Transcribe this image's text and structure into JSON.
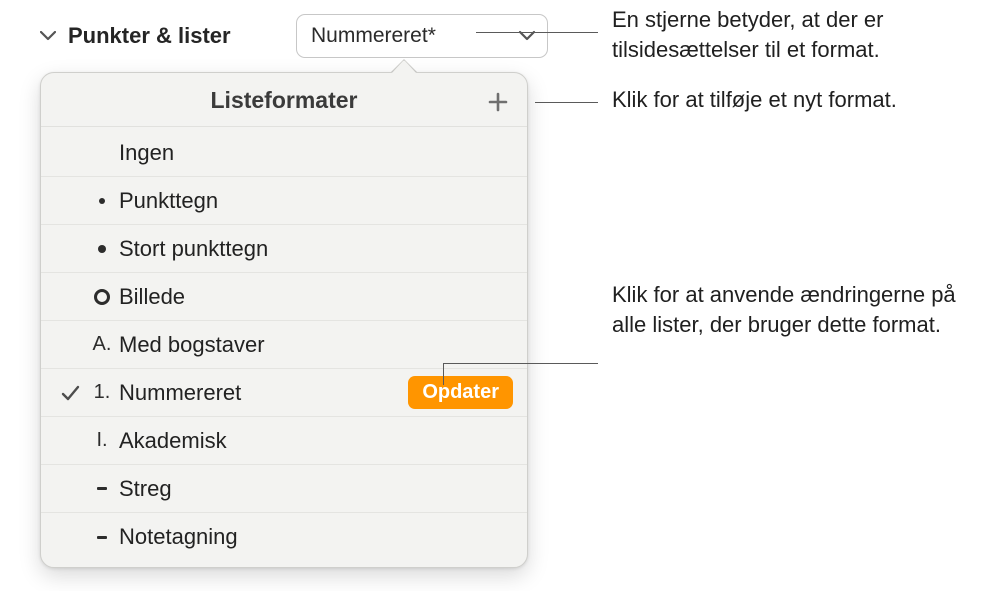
{
  "panel": {
    "section_title": "Punkter & lister",
    "dropdown_value": "Nummereret*"
  },
  "popover": {
    "title": "Listeformater",
    "update_label": "Opdater",
    "items": [
      {
        "marker_type": "none",
        "label": "Ingen",
        "checked": false
      },
      {
        "marker_type": "dot_sm",
        "label": "Punkttegn",
        "checked": false
      },
      {
        "marker_type": "dot_lg",
        "label": "Stort punkttegn",
        "checked": false
      },
      {
        "marker_type": "circle",
        "label": "Billede",
        "checked": false
      },
      {
        "marker_type": "letter",
        "marker_text": "A.",
        "label": "Med bogstaver",
        "checked": false
      },
      {
        "marker_type": "number",
        "marker_text": "1.",
        "label": "Nummereret",
        "checked": true,
        "has_update": true
      },
      {
        "marker_type": "roman",
        "marker_text": "I.",
        "label": "Akademisk",
        "checked": false
      },
      {
        "marker_type": "dash",
        "label": "Streg",
        "checked": false
      },
      {
        "marker_type": "dash",
        "label": "Notetagning",
        "checked": false
      }
    ]
  },
  "callouts": {
    "asterisk_note": "En stjerne betyder, at der er tilsidesættelser til et format.",
    "add_note": "Klik for at tilføje et nyt format.",
    "update_note": "Klik for at anvende ændringerne på alle lister, der bruger dette format."
  }
}
